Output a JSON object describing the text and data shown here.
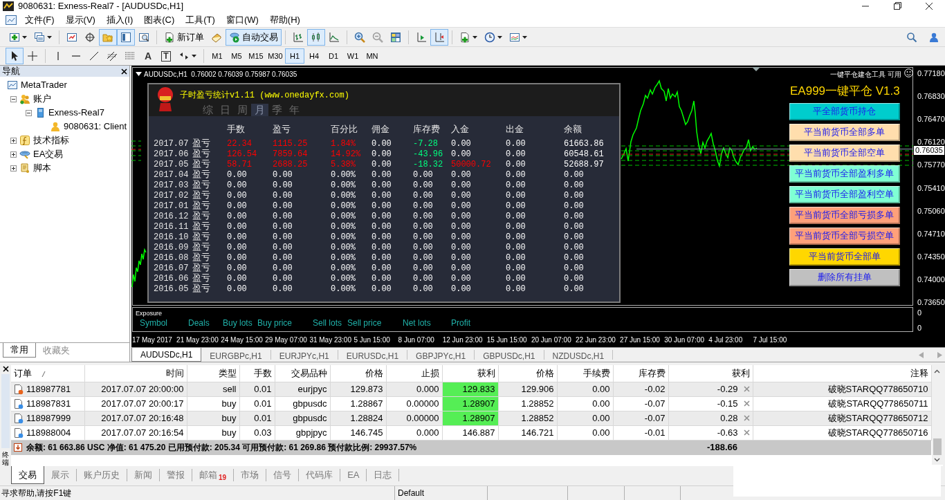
{
  "window": {
    "title": "9080631: Exness-Real7 - [AUDUSDc,H1]"
  },
  "menu": [
    "文件(F)",
    "显示(V)",
    "插入(I)",
    "图表(C)",
    "工具(T)",
    "窗口(W)",
    "帮助(H)"
  ],
  "toolbar": [
    {
      "pressed": false
    },
    {
      "pressed": false
    },
    {
      "pressed": false
    },
    {
      "pressed": false
    },
    {
      "pressed": true
    },
    {
      "pressed": true
    },
    {
      "pressed": false
    },
    {
      "label": "新订单",
      "pressed": false
    },
    {
      "pressed": false
    },
    {
      "label": "自动交易",
      "pressed": true
    },
    {
      "pressed": false
    },
    {
      "pressed": true
    },
    {
      "pressed": false
    },
    {
      "pressed": false
    },
    {
      "pressed": false
    },
    {
      "pressed": false
    },
    {
      "pressed": false
    },
    {
      "pressed": true
    },
    {
      "pressed": false
    },
    {
      "pressed": false
    },
    {
      "pressed": false
    }
  ],
  "drawing_toolbar": [
    {
      "pressed": true
    },
    {
      "pressed": false
    },
    {
      "pressed": false
    },
    {
      "pressed": false
    },
    {
      "pressed": false
    },
    {
      "pressed": false
    },
    {
      "pressed": false
    },
    {
      "label": "A",
      "pressed": false
    },
    {
      "label": "T",
      "pressed": false
    },
    {
      "pressed": false
    }
  ],
  "timeframes": [
    {
      "label": "M1",
      "selected": false
    },
    {
      "label": "M5",
      "selected": false
    },
    {
      "label": "M15",
      "selected": false
    },
    {
      "label": "M30",
      "selected": false
    },
    {
      "label": "H1",
      "selected": true
    },
    {
      "label": "H4",
      "selected": false
    },
    {
      "label": "D1",
      "selected": false
    },
    {
      "label": "W1",
      "selected": false
    },
    {
      "label": "MN",
      "selected": false
    }
  ],
  "navigator": {
    "title": "导航",
    "tree": [
      {
        "label": "MetaTrader",
        "kind": "root",
        "children": [
          {
            "label": "账户",
            "kind": "accounts",
            "expanded": true,
            "children": [
              {
                "label": "Exness-Real7",
                "kind": "server",
                "expanded": true,
                "children": [
                  {
                    "label": "9080631: Client",
                    "kind": "account"
                  }
                ]
              }
            ]
          },
          {
            "label": "技术指标",
            "kind": "indicators",
            "expanded": false
          },
          {
            "label": "EA交易",
            "kind": "experts",
            "expanded": false
          },
          {
            "label": "脚本",
            "kind": "scripts",
            "expanded": false
          }
        ]
      }
    ],
    "tabs": [
      {
        "label": "常用",
        "selected": true
      },
      {
        "label": "收藏夹",
        "selected": false
      }
    ]
  },
  "chart": {
    "header": "AUDUSDc,H1  0.76002 0.76039 0.75987 0.76035",
    "tool_label": "一键平仓建仓工具",
    "status_label": "可用",
    "price_axis": [
      "0.77180",
      "0.76830",
      "0.76470",
      "0.76120",
      "0.75770",
      "0.75410",
      "0.75060",
      "0.74710",
      "0.74350",
      "0.74000",
      "0.73650"
    ],
    "current_price": "0.76035",
    "subwindow_axis": [
      "0",
      "0"
    ],
    "time_axis": [
      "17 May 2017",
      "21 May 23:00",
      "24 May 15:00",
      "29 May 07:00",
      "31 May 23:00",
      "5 Jun 15:00",
      "8 Jun 07:00",
      "12 Jun 23:00",
      "15 Jun 15:00",
      "20 Jun 07:00",
      "22 Jun 23:00",
      "27 Jun 15:00",
      "30 Jun 07:00",
      "4 Jul 23:00",
      "7 Jul 15:00"
    ],
    "exposure": {
      "title": "Exposure",
      "columns": [
        "Symbol",
        "Deals",
        "Buy lots",
        "Buy price",
        "Sell lots",
        "Sell price",
        "Net lots",
        "Profit"
      ]
    }
  },
  "stats_panel": {
    "title": "子时盈亏统计v1.11 (www.onedayfx.com)",
    "periods": [
      {
        "label": "综",
        "selected": false
      },
      {
        "label": "日",
        "selected": false
      },
      {
        "label": "周",
        "selected": false
      },
      {
        "label": "月",
        "selected": true
      },
      {
        "label": "季",
        "selected": false
      },
      {
        "label": "年",
        "selected": false
      }
    ],
    "columns": [
      "手数",
      "盈亏",
      "百分比",
      "佣金",
      "库存费",
      "入金",
      "出金",
      "余额"
    ],
    "rows": [
      {
        "period": "2017.07",
        "label": "盈亏",
        "cells": [
          {
            "text": "22.34",
            "color": "#ff0000"
          },
          {
            "text": "1115.25",
            "color": "#ff0000"
          },
          {
            "text": "1.84%",
            "color": "#ff0000"
          },
          {
            "text": "0.00",
            "color": "#ffffff"
          },
          {
            "text": "-7.28",
            "color": "#00ff7f"
          },
          {
            "text": "0.00",
            "color": "#ffffff"
          },
          {
            "text": "0.00",
            "color": "#ffffff"
          },
          {
            "text": "61663.86",
            "color": "#ffffff"
          }
        ]
      },
      {
        "period": "2017.06",
        "label": "盈亏",
        "cells": [
          {
            "text": "126.54",
            "color": "#ff0000"
          },
          {
            "text": "7859.64",
            "color": "#ff0000"
          },
          {
            "text": "14.92%",
            "color": "#ff0000"
          },
          {
            "text": "0.00",
            "color": "#ffffff"
          },
          {
            "text": "-43.96",
            "color": "#00ff7f"
          },
          {
            "text": "0.00",
            "color": "#ffffff"
          },
          {
            "text": "0.00",
            "color": "#ffffff"
          },
          {
            "text": "60548.61",
            "color": "#ffffff"
          }
        ]
      },
      {
        "period": "2017.05",
        "label": "盈亏",
        "cells": [
          {
            "text": "58.71",
            "color": "#ff0000"
          },
          {
            "text": "2688.25",
            "color": "#ff0000"
          },
          {
            "text": "5.38%",
            "color": "#ff0000"
          },
          {
            "text": "0.00",
            "color": "#ffffff"
          },
          {
            "text": "-18.32",
            "color": "#00ff7f"
          },
          {
            "text": "50000.72",
            "color": "#ff0000"
          },
          {
            "text": "0.00",
            "color": "#ffffff"
          },
          {
            "text": "52688.97",
            "color": "#ffffff"
          }
        ]
      },
      {
        "period": "2017.04",
        "label": "盈亏",
        "cells": [
          {
            "text": "0.00",
            "color": "#ffffff"
          },
          {
            "text": "0.00",
            "color": "#ffffff"
          },
          {
            "text": "0.00%",
            "color": "#ffffff"
          },
          {
            "text": "0.00",
            "color": "#ffffff"
          },
          {
            "text": "0.00",
            "color": "#ffffff"
          },
          {
            "text": "0.00",
            "color": "#ffffff"
          },
          {
            "text": "0.00",
            "color": "#ffffff"
          },
          {
            "text": "0.00",
            "color": "#ffffff"
          }
        ]
      },
      {
        "period": "2017.03",
        "label": "盈亏",
        "cells": [
          {
            "text": "0.00",
            "color": "#ffffff"
          },
          {
            "text": "0.00",
            "color": "#ffffff"
          },
          {
            "text": "0.00%",
            "color": "#ffffff"
          },
          {
            "text": "0.00",
            "color": "#ffffff"
          },
          {
            "text": "0.00",
            "color": "#ffffff"
          },
          {
            "text": "0.00",
            "color": "#ffffff"
          },
          {
            "text": "0.00",
            "color": "#ffffff"
          },
          {
            "text": "0.00",
            "color": "#ffffff"
          }
        ]
      },
      {
        "period": "2017.02",
        "label": "盈亏",
        "cells": [
          {
            "text": "0.00",
            "color": "#ffffff"
          },
          {
            "text": "0.00",
            "color": "#ffffff"
          },
          {
            "text": "0.00%",
            "color": "#ffffff"
          },
          {
            "text": "0.00",
            "color": "#ffffff"
          },
          {
            "text": "0.00",
            "color": "#ffffff"
          },
          {
            "text": "0.00",
            "color": "#ffffff"
          },
          {
            "text": "0.00",
            "color": "#ffffff"
          },
          {
            "text": "0.00",
            "color": "#ffffff"
          }
        ]
      },
      {
        "period": "2017.01",
        "label": "盈亏",
        "cells": [
          {
            "text": "0.00",
            "color": "#ffffff"
          },
          {
            "text": "0.00",
            "color": "#ffffff"
          },
          {
            "text": "0.00%",
            "color": "#ffffff"
          },
          {
            "text": "0.00",
            "color": "#ffffff"
          },
          {
            "text": "0.00",
            "color": "#ffffff"
          },
          {
            "text": "0.00",
            "color": "#ffffff"
          },
          {
            "text": "0.00",
            "color": "#ffffff"
          },
          {
            "text": "0.00",
            "color": "#ffffff"
          }
        ]
      },
      {
        "period": "2016.12",
        "label": "盈亏",
        "cells": [
          {
            "text": "0.00",
            "color": "#ffffff"
          },
          {
            "text": "0.00",
            "color": "#ffffff"
          },
          {
            "text": "0.00%",
            "color": "#ffffff"
          },
          {
            "text": "0.00",
            "color": "#ffffff"
          },
          {
            "text": "0.00",
            "color": "#ffffff"
          },
          {
            "text": "0.00",
            "color": "#ffffff"
          },
          {
            "text": "0.00",
            "color": "#ffffff"
          },
          {
            "text": "0.00",
            "color": "#ffffff"
          }
        ]
      },
      {
        "period": "2016.11",
        "label": "盈亏",
        "cells": [
          {
            "text": "0.00",
            "color": "#ffffff"
          },
          {
            "text": "0.00",
            "color": "#ffffff"
          },
          {
            "text": "0.00%",
            "color": "#ffffff"
          },
          {
            "text": "0.00",
            "color": "#ffffff"
          },
          {
            "text": "0.00",
            "color": "#ffffff"
          },
          {
            "text": "0.00",
            "color": "#ffffff"
          },
          {
            "text": "0.00",
            "color": "#ffffff"
          },
          {
            "text": "0.00",
            "color": "#ffffff"
          }
        ]
      },
      {
        "period": "2016.10",
        "label": "盈亏",
        "cells": [
          {
            "text": "0.00",
            "color": "#ffffff"
          },
          {
            "text": "0.00",
            "color": "#ffffff"
          },
          {
            "text": "0.00%",
            "color": "#ffffff"
          },
          {
            "text": "0.00",
            "color": "#ffffff"
          },
          {
            "text": "0.00",
            "color": "#ffffff"
          },
          {
            "text": "0.00",
            "color": "#ffffff"
          },
          {
            "text": "0.00",
            "color": "#ffffff"
          },
          {
            "text": "0.00",
            "color": "#ffffff"
          }
        ]
      },
      {
        "period": "2016.09",
        "label": "盈亏",
        "cells": [
          {
            "text": "0.00",
            "color": "#ffffff"
          },
          {
            "text": "0.00",
            "color": "#ffffff"
          },
          {
            "text": "0.00%",
            "color": "#ffffff"
          },
          {
            "text": "0.00",
            "color": "#ffffff"
          },
          {
            "text": "0.00",
            "color": "#ffffff"
          },
          {
            "text": "0.00",
            "color": "#ffffff"
          },
          {
            "text": "0.00",
            "color": "#ffffff"
          },
          {
            "text": "0.00",
            "color": "#ffffff"
          }
        ]
      },
      {
        "period": "2016.08",
        "label": "盈亏",
        "cells": [
          {
            "text": "0.00",
            "color": "#ffffff"
          },
          {
            "text": "0.00",
            "color": "#ffffff"
          },
          {
            "text": "0.00%",
            "color": "#ffffff"
          },
          {
            "text": "0.00",
            "color": "#ffffff"
          },
          {
            "text": "0.00",
            "color": "#ffffff"
          },
          {
            "text": "0.00",
            "color": "#ffffff"
          },
          {
            "text": "0.00",
            "color": "#ffffff"
          },
          {
            "text": "0.00",
            "color": "#ffffff"
          }
        ]
      },
      {
        "period": "2016.07",
        "label": "盈亏",
        "cells": [
          {
            "text": "0.00",
            "color": "#ffffff"
          },
          {
            "text": "0.00",
            "color": "#ffffff"
          },
          {
            "text": "0.00%",
            "color": "#ffffff"
          },
          {
            "text": "0.00",
            "color": "#ffffff"
          },
          {
            "text": "0.00",
            "color": "#ffffff"
          },
          {
            "text": "0.00",
            "color": "#ffffff"
          },
          {
            "text": "0.00",
            "color": "#ffffff"
          },
          {
            "text": "0.00",
            "color": "#ffffff"
          }
        ]
      },
      {
        "period": "2016.06",
        "label": "盈亏",
        "cells": [
          {
            "text": "0.00",
            "color": "#ffffff"
          },
          {
            "text": "0.00",
            "color": "#ffffff"
          },
          {
            "text": "0.00%",
            "color": "#ffffff"
          },
          {
            "text": "0.00",
            "color": "#ffffff"
          },
          {
            "text": "0.00",
            "color": "#ffffff"
          },
          {
            "text": "0.00",
            "color": "#ffffff"
          },
          {
            "text": "0.00",
            "color": "#ffffff"
          },
          {
            "text": "0.00",
            "color": "#ffffff"
          }
        ]
      },
      {
        "period": "2016.05",
        "label": "盈亏",
        "cells": [
          {
            "text": "0.00",
            "color": "#ffffff"
          },
          {
            "text": "0.00",
            "color": "#ffffff"
          },
          {
            "text": "0.00%",
            "color": "#ffffff"
          },
          {
            "text": "0.00",
            "color": "#ffffff"
          },
          {
            "text": "0.00",
            "color": "#ffffff"
          },
          {
            "text": "0.00",
            "color": "#ffffff"
          },
          {
            "text": "0.00",
            "color": "#ffffff"
          },
          {
            "text": "0.00",
            "color": "#ffffff"
          }
        ]
      }
    ]
  },
  "ea_panel": {
    "title": "EA999一键平仓 V1.3",
    "buttons": [
      {
        "label": "平全部货币持仓",
        "color": "#00cdcd"
      },
      {
        "label": "平当前货币全部多单",
        "color": "#ffdead"
      },
      {
        "label": "平当前货币全部空单",
        "color": "#ffdead"
      },
      {
        "label": "平当前货币全部盈利多单",
        "color": "#7fffd4"
      },
      {
        "label": "平当前货币全部盈利空单",
        "color": "#7fffd4"
      },
      {
        "label": "平当前货币全部亏损多单",
        "color": "#ffa07a"
      },
      {
        "label": "平当前货币全部亏损空单",
        "color": "#ffa07a"
      },
      {
        "label": "平当前货币全部单",
        "color": "#ffd700"
      },
      {
        "label": "删除所有挂单",
        "color": "#c0c0c0"
      }
    ]
  },
  "chart_tabs": [
    {
      "label": "AUDUSDc,H1",
      "selected": true
    },
    {
      "label": "EURGBPc,H1",
      "selected": false
    },
    {
      "label": "EURJPYc,H1",
      "selected": false
    },
    {
      "label": "EURUSDc,H1",
      "selected": false
    },
    {
      "label": "GBPJPYc,H1",
      "selected": false
    },
    {
      "label": "GBPUSDc,H1",
      "selected": false
    },
    {
      "label": "NZDUSDc,H1",
      "selected": false
    }
  ],
  "terminal": {
    "side_label": "终端",
    "columns": [
      {
        "label": "订单",
        "sorted": true
      },
      {
        "label": "时间",
        "sorted": false
      },
      {
        "label": "类型",
        "sorted": false
      },
      {
        "label": "手数",
        "sorted": false
      },
      {
        "label": "交易品种",
        "sorted": false
      },
      {
        "label": "价格",
        "sorted": false
      },
      {
        "label": "止损",
        "sorted": false
      },
      {
        "label": "获利",
        "sorted": false
      },
      {
        "label": "价格",
        "sorted": false
      },
      {
        "label": "手续费",
        "sorted": false
      },
      {
        "label": "库存费",
        "sorted": false
      },
      {
        "label": "获利",
        "sorted": false
      },
      {
        "label": "注释",
        "sorted": false
      }
    ],
    "rows": [
      {
        "kind": "sell",
        "tp_hit": true,
        "cells": [
          "118987781",
          "2017.07.07 20:00:00",
          "sell",
          "0.01",
          "eurjpyc",
          "129.873",
          "0.000",
          "129.833",
          "129.906",
          "0.00",
          "-0.02",
          "-0.29",
          "破晓STARQQ778650710"
        ]
      },
      {
        "kind": "buy",
        "tp_hit": true,
        "cells": [
          "118987831",
          "2017.07.07 20:00:17",
          "buy",
          "0.01",
          "gbpusdc",
          "1.28867",
          "0.00000",
          "1.28907",
          "1.28852",
          "0.00",
          "-0.07",
          "-0.15",
          "破晓STARQQ778650711"
        ]
      },
      {
        "kind": "buy",
        "tp_hit": true,
        "cells": [
          "118987999",
          "2017.07.07 20:16:48",
          "buy",
          "0.01",
          "gbpusdc",
          "1.28824",
          "0.00000",
          "1.28907",
          "1.28852",
          "0.00",
          "-0.07",
          "0.28",
          "破晓STARQQ778650712"
        ]
      },
      {
        "kind": "buy",
        "tp_hit": false,
        "cells": [
          "118988004",
          "2017.07.07 20:16:54",
          "buy",
          "0.03",
          "gbpjpyc",
          "146.745",
          "0.000",
          "146.887",
          "146.721",
          "0.00",
          "-0.01",
          "-0.63",
          "破晓STARQQ778650716"
        ]
      }
    ],
    "summary": {
      "text": "余额: 61 663.86 USC  净值: 61 475.20  已用预付款: 205.34  可用预付款: 61 269.86  预付款比例: 29937.57%",
      "profit": "-188.66"
    },
    "tabs": [
      {
        "label": "交易",
        "selected": true
      },
      {
        "label": "展示",
        "selected": false
      },
      {
        "label": "账户历史",
        "selected": false
      },
      {
        "label": "新闻",
        "selected": false
      },
      {
        "label": "警报",
        "selected": false
      },
      {
        "label": "邮箱",
        "badge": "19",
        "selected": false
      },
      {
        "label": "市场",
        "selected": false
      },
      {
        "label": "信号",
        "selected": false
      },
      {
        "label": "代码库",
        "selected": false
      },
      {
        "label": "EA",
        "selected": false
      },
      {
        "label": "日志",
        "selected": false
      }
    ]
  },
  "status_bar": {
    "help": "寻求帮助,请按F1键",
    "profile": "Default"
  }
}
